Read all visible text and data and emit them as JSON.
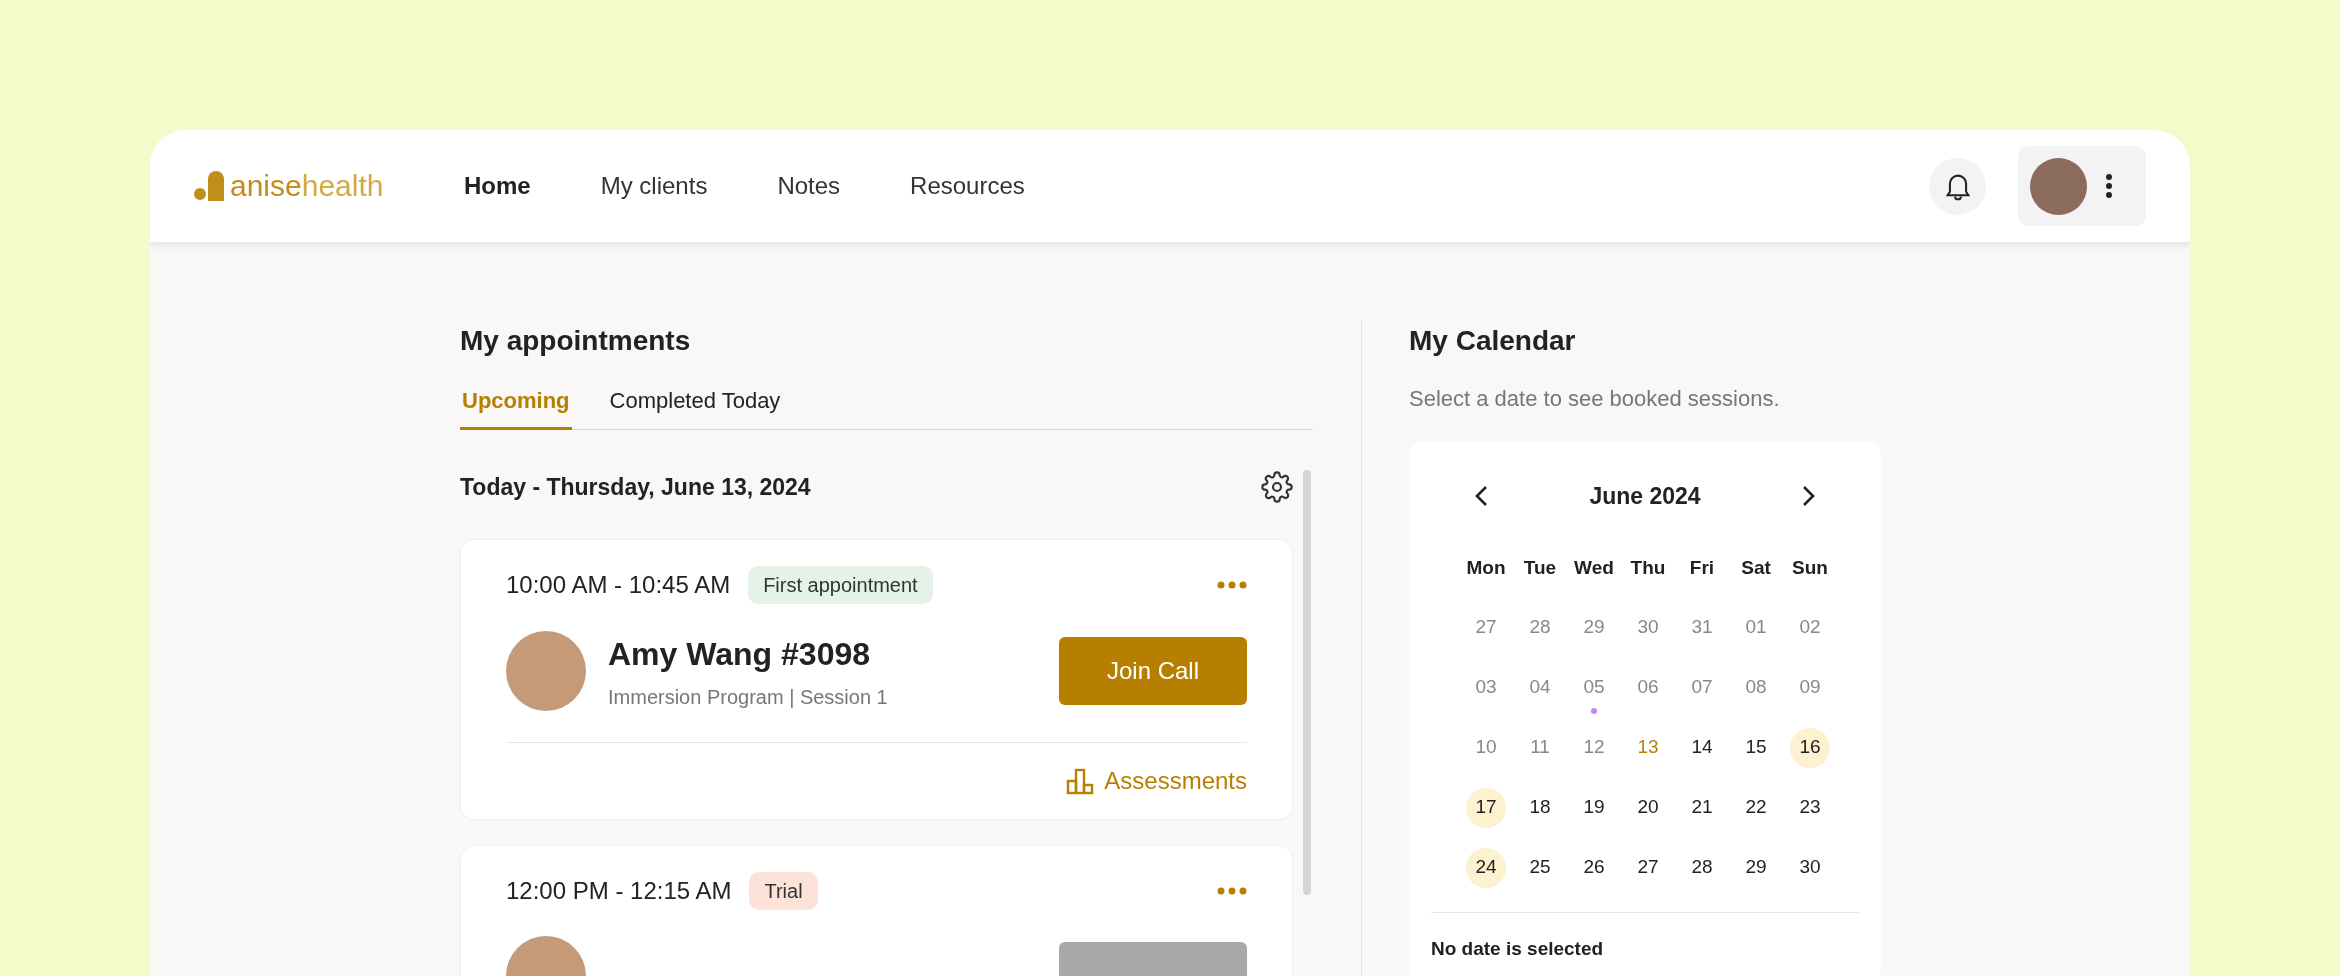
{
  "logo": {
    "word_1": "anise",
    "word_2": "health"
  },
  "nav": [
    {
      "label": "Home",
      "selected": true
    },
    {
      "label": "My clients",
      "selected": false
    },
    {
      "label": "Notes",
      "selected": false
    },
    {
      "label": "Resources",
      "selected": false
    }
  ],
  "appointments_panel": {
    "title": "My appointments",
    "tabs": [
      {
        "label": "Upcoming",
        "selected": true
      },
      {
        "label": "Completed Today",
        "selected": false
      }
    ],
    "date_heading": "Today - Thursday, June 13, 2024",
    "appointments": [
      {
        "time": "10:00 AM - 10:45 AM",
        "tag": {
          "label": "First appointment",
          "color": "#e4f2e7"
        },
        "name": "Amy Wang #3098",
        "program": "Immersion Program | Session 1",
        "button": {
          "label": "Join Call",
          "disabled": false
        },
        "link": "Assessments"
      },
      {
        "time": "12:00 PM - 12:15 AM",
        "tag": {
          "label": "Trial",
          "color": "#fde2d9"
        },
        "button": {
          "disabled": true
        }
      }
    ]
  },
  "calendar": {
    "title": "My Calendar",
    "subtitle": "Select a date to see booked sessions.",
    "month": "June 2024",
    "weekdays": [
      "Mon",
      "Tue",
      "Wed",
      "Thu",
      "Fri",
      "Sat",
      "Sun"
    ],
    "days": [
      {
        "label": "27",
        "muted": true,
        "today": false,
        "booked": false,
        "event": false
      },
      {
        "label": "28",
        "muted": true,
        "today": false,
        "booked": false,
        "event": false
      },
      {
        "label": "29",
        "muted": true,
        "today": false,
        "booked": false,
        "event": false
      },
      {
        "label": "30",
        "muted": true,
        "today": false,
        "booked": false,
        "event": false
      },
      {
        "label": "31",
        "muted": true,
        "today": false,
        "booked": false,
        "event": false
      },
      {
        "label": "01",
        "muted": true,
        "today": false,
        "booked": false,
        "event": false
      },
      {
        "label": "02",
        "muted": true,
        "today": false,
        "booked": false,
        "event": false
      },
      {
        "label": "03",
        "muted": true,
        "today": false,
        "booked": false,
        "event": false
      },
      {
        "label": "04",
        "muted": true,
        "today": false,
        "booked": false,
        "event": false
      },
      {
        "label": "05",
        "muted": true,
        "today": false,
        "booked": false,
        "event": true
      },
      {
        "label": "06",
        "muted": true,
        "today": false,
        "booked": false,
        "event": false
      },
      {
        "label": "07",
        "muted": true,
        "today": false,
        "booked": false,
        "event": false
      },
      {
        "label": "08",
        "muted": true,
        "today": false,
        "booked": false,
        "event": false
      },
      {
        "label": "09",
        "muted": true,
        "today": false,
        "booked": false,
        "event": false
      },
      {
        "label": "10",
        "muted": true,
        "today": false,
        "booked": false,
        "event": false
      },
      {
        "label": "11",
        "muted": true,
        "today": false,
        "booked": false,
        "event": false
      },
      {
        "label": "12",
        "muted": true,
        "today": false,
        "booked": false,
        "event": false
      },
      {
        "label": "13",
        "muted": false,
        "today": true,
        "booked": false,
        "event": false
      },
      {
        "label": "14",
        "muted": false,
        "today": false,
        "booked": false,
        "event": false
      },
      {
        "label": "15",
        "muted": false,
        "today": false,
        "booked": false,
        "event": false
      },
      {
        "label": "16",
        "muted": false,
        "today": false,
        "booked": true,
        "event": false
      },
      {
        "label": "17",
        "muted": false,
        "today": false,
        "booked": true,
        "event": false
      },
      {
        "label": "18",
        "muted": false,
        "today": false,
        "booked": false,
        "event": false
      },
      {
        "label": "19",
        "muted": false,
        "today": false,
        "booked": false,
        "event": false
      },
      {
        "label": "20",
        "muted": false,
        "today": false,
        "booked": false,
        "event": false
      },
      {
        "label": "21",
        "muted": false,
        "today": false,
        "booked": false,
        "event": false
      },
      {
        "label": "22",
        "muted": false,
        "today": false,
        "booked": false,
        "event": false
      },
      {
        "label": "23",
        "muted": false,
        "today": false,
        "booked": false,
        "event": false
      },
      {
        "label": "24",
        "muted": false,
        "today": false,
        "booked": true,
        "event": false
      },
      {
        "label": "25",
        "muted": false,
        "today": false,
        "booked": false,
        "event": false
      },
      {
        "label": "26",
        "muted": false,
        "today": false,
        "booked": false,
        "event": false
      },
      {
        "label": "27",
        "muted": false,
        "today": false,
        "booked": false,
        "event": false
      },
      {
        "label": "28",
        "muted": false,
        "today": false,
        "booked": false,
        "event": false
      },
      {
        "label": "29",
        "muted": false,
        "today": false,
        "booked": false,
        "event": false
      },
      {
        "label": "30",
        "muted": false,
        "today": false,
        "booked": false,
        "event": false
      }
    ],
    "footer": "No date is selected"
  }
}
